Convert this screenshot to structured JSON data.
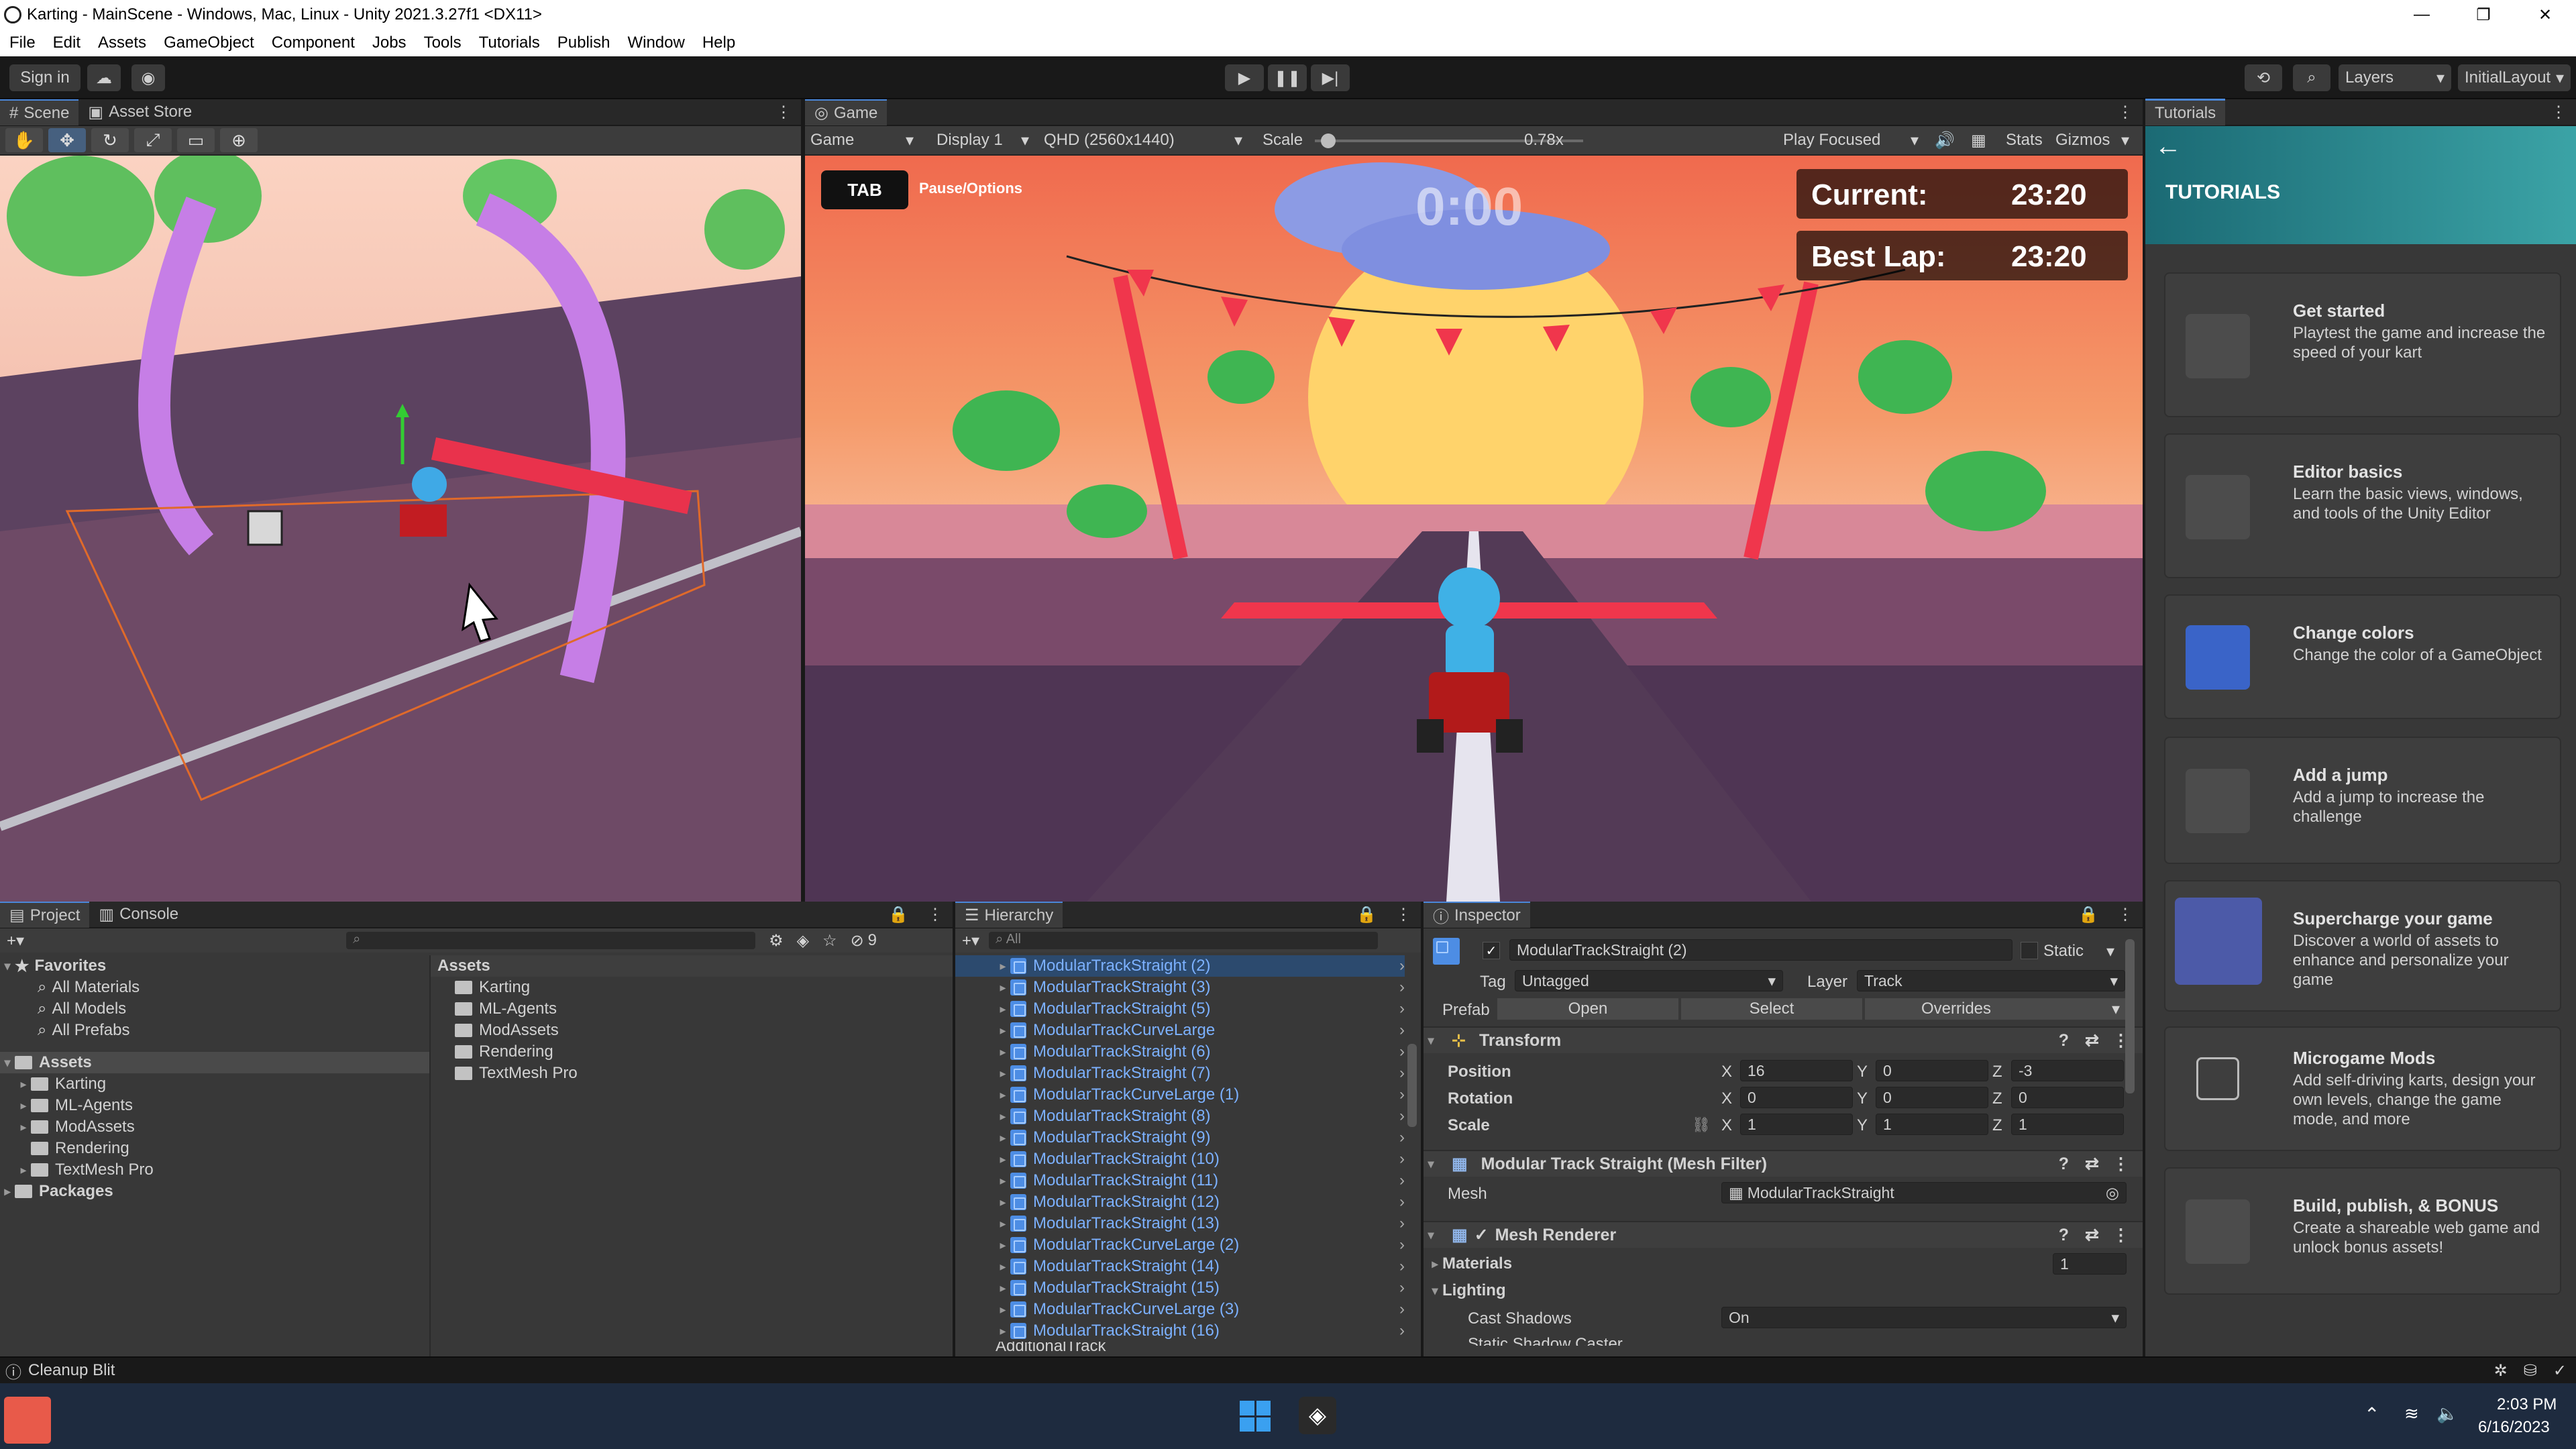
{
  "window": {
    "title": "Karting - MainScene - Windows, Mac, Linux - Unity 2021.3.27f1 <DX11>"
  },
  "menu": [
    "File",
    "Edit",
    "Assets",
    "GameObject",
    "Component",
    "Jobs",
    "Tools",
    "Tutorials",
    "Publish",
    "Window",
    "Help"
  ],
  "toolbar": {
    "sign_in": "Sign in",
    "layers": "Layers",
    "layout": "InitialLayout"
  },
  "scene_tabs": {
    "scene": "Scene",
    "asset_store": "Asset Store"
  },
  "game": {
    "tab": "Game",
    "mode": "Game",
    "display": "Display 1",
    "resolution": "QHD (2560x1440)",
    "scale_label": "Scale",
    "scale_value": "0.78x",
    "scale_fraction": 0.05,
    "play_focused": "Play Focused",
    "stats": "Stats",
    "gizmos": "Gizmos",
    "hud": {
      "tab_key": "TAB",
      "pause": "Pause/Options",
      "timer": "0:00",
      "current_label": "Current:",
      "current_value": "23:20",
      "best_label": "Best Lap:",
      "best_value": "23:20"
    }
  },
  "project": {
    "tabs": [
      "Project",
      "Console"
    ],
    "favorites_label": "Favorites",
    "favorites": [
      "All Materials",
      "All Models",
      "All Prefabs"
    ],
    "assets_label": "Assets",
    "assets_tree": [
      "Karting",
      "ML-Agents",
      "ModAssets",
      "Rendering",
      "TextMesh Pro"
    ],
    "packages_label": "Packages",
    "assets_header": "Assets",
    "assets_list": [
      "Karting",
      "ML-Agents",
      "ModAssets",
      "Rendering",
      "TextMesh Pro"
    ],
    "hidden_count": "9"
  },
  "hierarchy": {
    "tab": "Hierarchy",
    "search_placeholder": "All",
    "items": [
      "ModularTrackStraight (2)",
      "ModularTrackStraight (3)",
      "ModularTrackStraight (5)",
      "ModularTrackCurveLarge",
      "ModularTrackStraight (6)",
      "ModularTrackStraight (7)",
      "ModularTrackCurveLarge (1)",
      "ModularTrackStraight (8)",
      "ModularTrackStraight (9)",
      "ModularTrackStraight (10)",
      "ModularTrackStraight (11)",
      "ModularTrackStraight (12)",
      "ModularTrackStraight (13)",
      "ModularTrackCurveLarge (2)",
      "ModularTrackStraight (14)",
      "ModularTrackStraight (15)",
      "ModularTrackCurveLarge (3)",
      "ModularTrackStraight (16)"
    ],
    "partial_item": "AdditionalTrack"
  },
  "inspector": {
    "tab": "Inspector",
    "object_name": "ModularTrackStraight (2)",
    "static_label": "Static",
    "tag_label": "Tag",
    "tag_value": "Untagged",
    "layer_label": "Layer",
    "layer_value": "Track",
    "prefab_label": "Prefab",
    "prefab_open": "Open",
    "prefab_select": "Select",
    "prefab_overrides": "Overrides",
    "transform_title": "Transform",
    "position_label": "Position",
    "rotation_label": "Rotation",
    "scale_label": "Scale",
    "position": {
      "x": "16",
      "y": "0",
      "z": "-3"
    },
    "rotation": {
      "x": "0",
      "y": "0",
      "z": "0"
    },
    "scale": {
      "x": "1",
      "y": "1",
      "z": "1"
    },
    "axis": {
      "x": "X",
      "y": "Y",
      "z": "Z"
    },
    "mesh_filter_title": "Modular Track Straight (Mesh Filter)",
    "mesh_label": "Mesh",
    "mesh_value": "ModularTrackStraight",
    "mesh_renderer_title": "Mesh Renderer",
    "materials_label": "Materials",
    "materials_count": "1",
    "lighting_label": "Lighting",
    "cast_shadows_label": "Cast Shadows",
    "cast_shadows_value": "On",
    "partial_row": "Static Shadow Caster"
  },
  "tutorials": {
    "tab": "Tutorials",
    "heading": "TUTORIALS",
    "cards": [
      {
        "title": "Get started",
        "desc": "Playtest the game and increase the speed of your kart"
      },
      {
        "title": "Editor basics",
        "desc": "Learn the basic views, windows, and tools of the Unity Editor"
      },
      {
        "title": "Change colors",
        "desc": "Change the color of a GameObject"
      },
      {
        "title": "Add a jump",
        "desc": "Add a jump to increase the challenge"
      },
      {
        "title": "Supercharge your game",
        "desc": "Discover a world of assets to enhance and personalize your game"
      },
      {
        "title": "Microgame Mods",
        "desc": "Add self-driving karts, design your own levels, change the game mode, and more"
      },
      {
        "title": "Build, publish, & BONUS",
        "desc": "Create a shareable web game and unlock bonus assets!"
      }
    ]
  },
  "status": {
    "message": "Cleanup Blit"
  },
  "taskbar": {
    "time": "2:03 PM",
    "date": "6/16/2023"
  },
  "colors": {
    "accent": "#4a87d8",
    "selection_blue": "#7cb1ff",
    "panel": "#383838"
  }
}
